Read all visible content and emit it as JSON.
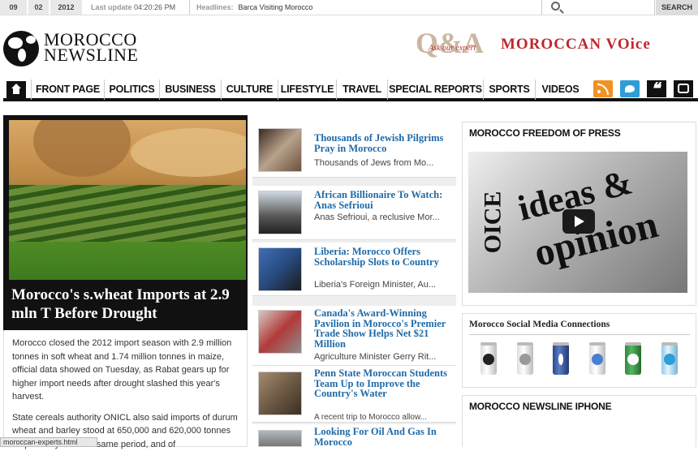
{
  "topbar": {
    "day": "09",
    "month": "02",
    "year": "2012",
    "last_update_label": "Last update",
    "last_update_time": "04:20:26 PM",
    "headlines_label": "Headlines:",
    "headline": "Barca Visiting Morocco",
    "search_button": "SEARCH"
  },
  "branding": {
    "logo_line1": "MOROCCO",
    "logo_line2": "NEWSLINE",
    "qa_text": "Q&A",
    "qa_sub": "Ask our expert",
    "voice": "MOROCCAN VOice"
  },
  "nav": {
    "items": [
      "FRONT PAGE",
      "POLITICS",
      "BUSINESS",
      "CULTURE",
      "LIFESTYLE",
      "TRAVEL",
      "SPECIAL REPORTS",
      "SPORTS",
      "VIDEOS"
    ]
  },
  "feature": {
    "headline": "Morocco's s.wheat Imports at 2.9 mln T Before Drought",
    "p1": "Morocco closed the 2012 import season with 2.9 million tonnes in soft wheat and 1.74 million tonnes in maize, official data showed on Tuesday, as Rabat gears up for higher import needs after drought slashed this year's harvest.",
    "p2": "State cereals authority ONICL also said imports of durum wheat and barley stood at 650,000 and 620,000 tonnes respectively over the same period, and of"
  },
  "status_bar": "moroccan-experts.html",
  "stories": [
    {
      "title": "Thousands of Jewish Pilgrims Pray in Morocco",
      "excerpt": "Thousands of Jews from Mo..."
    },
    {
      "title": "African Billionaire To Watch: Anas Sefrioui",
      "excerpt": "Anas Sefrioui, a reclusive Mor..."
    },
    {
      "title": "Liberia: Morocco Offers Scholarship Slots to Country",
      "excerpt": "Liberia's Foreign Minister, Au..."
    },
    {
      "title": "Canada's Award-Winning Pavilion in Morocco's Premier Trade Show Helps Net $21 Million",
      "excerpt": "Agriculture Minister Gerry Rit..."
    },
    {
      "title": "Penn State Moroccan Students Team Up to Improve the Country's Water",
      "excerpt": "A recent trip to Morocco allow..."
    },
    {
      "title": "Looking For Oil And Gas In Morocco",
      "excerpt": ""
    }
  ],
  "sidebar": {
    "freedom_title": "MOROCCO FREEDOM OF PRESS",
    "video_words": [
      "ideas &",
      "opinion",
      "OICE"
    ],
    "social_title": "Morocco Social Media Connections",
    "iphone_title": "MOROCCO NEWSLINE IPHONE",
    "social_icons": [
      "digg-icon",
      "myspace-icon",
      "facebook-icon",
      "google-icon",
      "stumbleupon-icon",
      "twitter-icon"
    ]
  }
}
